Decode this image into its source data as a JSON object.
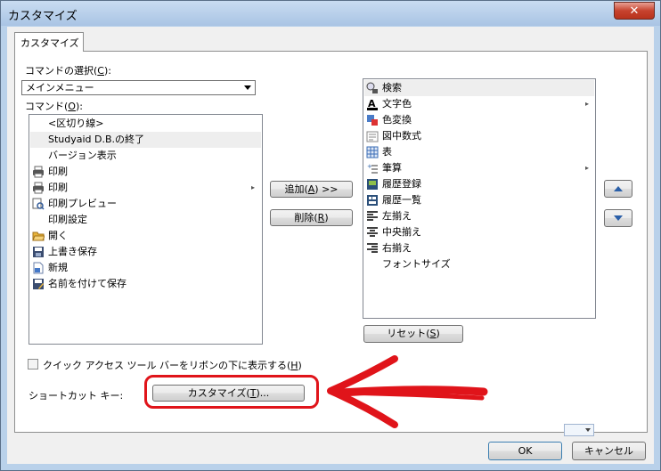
{
  "window": {
    "title": "カスタマイズ",
    "close_glyph": "✕"
  },
  "tab": {
    "label": "カスタマイズ"
  },
  "command_select": {
    "label": "コマンドの選択(",
    "key": "C",
    "label_end": "):",
    "value": "メインメニュー"
  },
  "commands": {
    "label": "コマンド(",
    "key": "O",
    "label_end": "):",
    "items": [
      {
        "label": "<区切り線>",
        "icon": "none"
      },
      {
        "label": "Studyaid D.B.の終了",
        "icon": "none",
        "highlight": true
      },
      {
        "label": "バージョン表示",
        "icon": "none"
      },
      {
        "label": "印刷",
        "icon": "printer-icon"
      },
      {
        "label": "印刷",
        "icon": "printer-icon",
        "submenu": true
      },
      {
        "label": "印刷プレビュー",
        "icon": "print-preview-icon"
      },
      {
        "label": "印刷設定",
        "icon": "none"
      },
      {
        "label": "開く",
        "icon": "folder-open-icon"
      },
      {
        "label": "上書き保存",
        "icon": "save-icon"
      },
      {
        "label": "新規",
        "icon": "new-document-icon"
      },
      {
        "label": "名前を付けて保存",
        "icon": "save-as-icon"
      }
    ]
  },
  "buttons": {
    "add": {
      "label": "追加(",
      "key": "A",
      "label_end": ") >>"
    },
    "remove": {
      "label": "削除(",
      "key": "R",
      "label_end": ")"
    },
    "reset": {
      "label": "リセット(",
      "key": "S",
      "label_end": ")"
    },
    "customize": {
      "label": "カスタマイズ(",
      "key": "T",
      "label_end": ")..."
    },
    "ok": "OK",
    "cancel": "キャンセル"
  },
  "toolbar_items": [
    {
      "label": "検索",
      "icon": "search-icon",
      "highlight": true
    },
    {
      "label": "文字色",
      "icon": "font-color-icon",
      "submenu": true
    },
    {
      "label": "色変換",
      "icon": "color-convert-icon"
    },
    {
      "label": "図中数式",
      "icon": "formula-icon"
    },
    {
      "label": "表",
      "icon": "table-icon"
    },
    {
      "label": "筆算",
      "icon": "calculation-icon",
      "submenu": true
    },
    {
      "label": "履歴登録",
      "icon": "history-register-icon"
    },
    {
      "label": "履歴一覧",
      "icon": "history-list-icon"
    },
    {
      "label": "左揃え",
      "icon": "align-left-icon"
    },
    {
      "label": "中央揃え",
      "icon": "align-center-icon"
    },
    {
      "label": "右揃え",
      "icon": "align-right-icon"
    },
    {
      "label": "フォントサイズ",
      "icon": "none",
      "combo": true
    }
  ],
  "checkbox": {
    "label": "クイック アクセス ツール バーをリボンの下に表示する(",
    "key": "H",
    "label_end": ")",
    "checked": false
  },
  "shortcut": {
    "label": "ショートカット キー:"
  },
  "colors": {
    "annotation": "#e0141a",
    "selection": "#eeeeee"
  }
}
